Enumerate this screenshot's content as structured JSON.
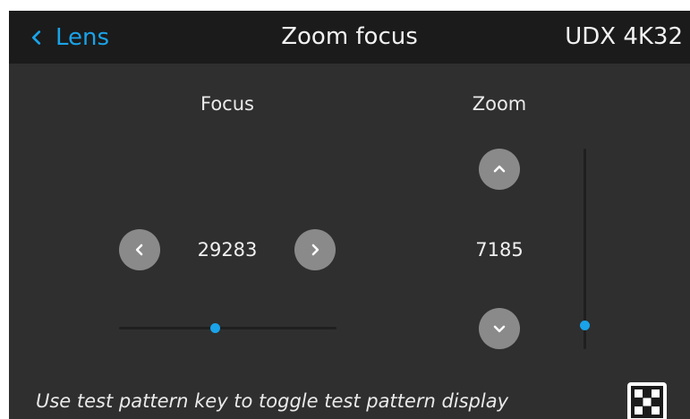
{
  "header": {
    "back_label": "Lens",
    "title": "Zoom focus",
    "model": "UDX 4K32"
  },
  "focus": {
    "label": "Focus",
    "value": "29283",
    "slider_fraction": 0.44
  },
  "zoom": {
    "label": "Zoom",
    "value": "7185",
    "slider_fraction": 0.88
  },
  "hint": "Use test pattern key to toggle test pattern display",
  "icons": {
    "back": "chevron-left-icon",
    "focus_decrease": "chevron-left-icon",
    "focus_increase": "chevron-right-icon",
    "zoom_increase": "chevron-up-icon",
    "zoom_decrease": "chevron-down-icon",
    "test_pattern": "test-pattern-icon"
  },
  "colors": {
    "accent": "#1aa3e8",
    "header_bg": "#1b1b1b",
    "panel_bg": "#2f2f2f",
    "button_bg": "#8a8a8a"
  }
}
